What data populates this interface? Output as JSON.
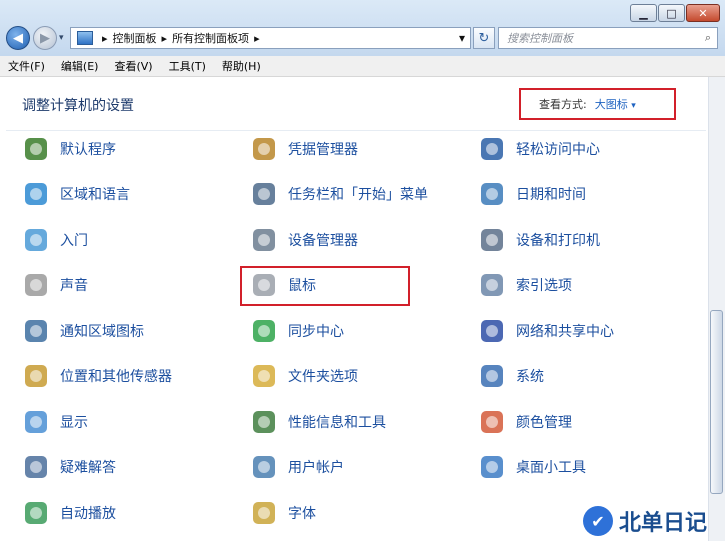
{
  "window": {
    "minimize": "▁",
    "maximize": "□",
    "close": "✕"
  },
  "nav": {
    "back_icon": "arrow-left-icon",
    "forward_icon": "arrow-right-icon"
  },
  "address": {
    "segments": [
      "控制面板",
      "所有控制面板项"
    ],
    "separator": "▸",
    "dropdown": "▾",
    "refresh": "↻"
  },
  "search": {
    "placeholder": "搜索控制面板"
  },
  "menu": [
    "文件(F)",
    "编辑(E)",
    "查看(V)",
    "工具(T)",
    "帮助(H)"
  ],
  "header": {
    "title": "调整计算机的设置"
  },
  "view_by": {
    "label": "查看方式:",
    "value": "大图标",
    "arrow": "▾"
  },
  "items": [
    {
      "label": "默认程序",
      "icon": "default-programs-icon"
    },
    {
      "label": "凭据管理器",
      "icon": "credential-manager-icon"
    },
    {
      "label": "轻松访问中心",
      "icon": "ease-of-access-icon"
    },
    {
      "label": "区域和语言",
      "icon": "globe-icon"
    },
    {
      "label": "任务栏和「开始」菜单",
      "icon": "taskbar-icon"
    },
    {
      "label": "日期和时间",
      "icon": "calendar-icon"
    },
    {
      "label": "入门",
      "icon": "getting-started-icon"
    },
    {
      "label": "设备管理器",
      "icon": "device-manager-icon"
    },
    {
      "label": "设备和打印机",
      "icon": "printer-icon"
    },
    {
      "label": "声音",
      "icon": "speaker-icon"
    },
    {
      "label": "鼠标",
      "icon": "mouse-icon"
    },
    {
      "label": "索引选项",
      "icon": "magnifier-icon"
    },
    {
      "label": "通知区域图标",
      "icon": "notification-icon"
    },
    {
      "label": "同步中心",
      "icon": "sync-icon"
    },
    {
      "label": "网络和共享中心",
      "icon": "network-icon"
    },
    {
      "label": "位置和其他传感器",
      "icon": "sensor-icon"
    },
    {
      "label": "文件夹选项",
      "icon": "folder-icon"
    },
    {
      "label": "系统",
      "icon": "system-icon"
    },
    {
      "label": "显示",
      "icon": "display-icon"
    },
    {
      "label": "性能信息和工具",
      "icon": "performance-icon"
    },
    {
      "label": "颜色管理",
      "icon": "color-icon"
    },
    {
      "label": "疑难解答",
      "icon": "troubleshoot-icon"
    },
    {
      "label": "用户帐户",
      "icon": "user-accounts-icon"
    },
    {
      "label": "桌面小工具",
      "icon": "gadgets-icon"
    },
    {
      "label": "自动播放",
      "icon": "autoplay-icon"
    },
    {
      "label": "字体",
      "icon": "fonts-icon"
    }
  ],
  "watermark": {
    "text": "北单日记",
    "icon": "checkmark-icon"
  }
}
